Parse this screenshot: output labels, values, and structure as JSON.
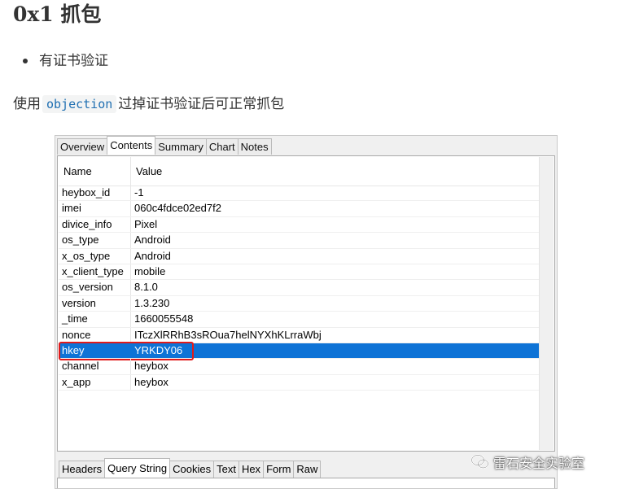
{
  "article": {
    "heading": "0x1 抓包",
    "bullets": [
      "有证书验证"
    ],
    "para_prefix": "使用",
    "para_code": "objection",
    "para_suffix": "过掉证书验证后可正常抓包"
  },
  "top_tabs": [
    {
      "label": "Overview",
      "active": false
    },
    {
      "label": "Contents",
      "active": true
    },
    {
      "label": "Summary",
      "active": false
    },
    {
      "label": "Chart",
      "active": false
    },
    {
      "label": "Notes",
      "active": false
    }
  ],
  "grid": {
    "col_name": "Name",
    "col_value": "Value",
    "rows": [
      {
        "name": "heybox_id",
        "value": "-1"
      },
      {
        "name": "imei",
        "value": "060c4fdce02ed7f2"
      },
      {
        "name": "divice_info",
        "value": "Pixel"
      },
      {
        "name": "os_type",
        "value": "Android"
      },
      {
        "name": "x_os_type",
        "value": "Android"
      },
      {
        "name": "x_client_type",
        "value": "mobile"
      },
      {
        "name": "os_version",
        "value": "8.1.0"
      },
      {
        "name": "version",
        "value": "1.3.230"
      },
      {
        "name": "_time",
        "value": "1660055548"
      },
      {
        "name": "nonce",
        "value": "ITczXlRRhB3sROua7helNYXhKLrraWbj"
      },
      {
        "name": "hkey",
        "value": "YRKDY06",
        "selected": true
      },
      {
        "name": "channel",
        "value": "heybox"
      },
      {
        "name": "x_app",
        "value": "heybox"
      }
    ]
  },
  "bottom_tabs": [
    {
      "label": "Headers",
      "active": false
    },
    {
      "label": "Query String",
      "active": true
    },
    {
      "label": "Cookies",
      "active": false
    },
    {
      "label": "Text",
      "active": false
    },
    {
      "label": "Hex",
      "active": false
    },
    {
      "label": "Form",
      "active": false
    },
    {
      "label": "Raw",
      "active": false
    }
  ],
  "watermark": {
    "text": "雷石安全实验室",
    "icon": "wechat-icon"
  },
  "colors": {
    "selection": "#0e73d6",
    "highlight_border": "#e01b1b",
    "code": "#1f6fb2"
  }
}
